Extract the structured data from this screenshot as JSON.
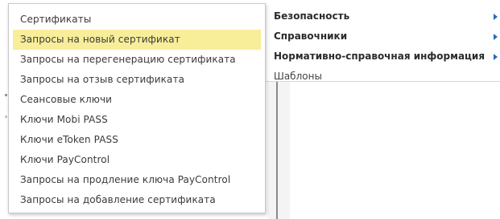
{
  "submenu": {
    "items": [
      {
        "label": "Сертификаты",
        "active": false
      },
      {
        "label": "Запросы на новый сертификат",
        "active": true
      },
      {
        "label": "Запросы на перегенерацию сертификата",
        "active": false
      },
      {
        "label": "Запросы на отзыв сертификата",
        "active": false
      },
      {
        "label": "Сеансовые ключи",
        "active": false
      },
      {
        "label": "Ключи Mobi PASS",
        "active": false
      },
      {
        "label": "Ключи eToken PASS",
        "active": false
      },
      {
        "label": "Ключи PayControl",
        "active": false
      },
      {
        "label": "Запросы на продление ключа PayControl",
        "active": false
      },
      {
        "label": "Запросы на добавление сертификата",
        "active": false
      }
    ]
  },
  "mainmenu": {
    "items": [
      {
        "label": "Безопасность",
        "has_submenu": true
      },
      {
        "label": "Справочники",
        "has_submenu": true
      },
      {
        "label": "Нормативно-справочная информация",
        "has_submenu": true
      },
      {
        "label": "Шаблоны",
        "has_submenu": false
      }
    ]
  },
  "colors": {
    "highlight": "#f8ee9a",
    "arrow": "#2c6bb5"
  },
  "icons": {
    "submenu_arrow": "triangle-right-icon"
  }
}
